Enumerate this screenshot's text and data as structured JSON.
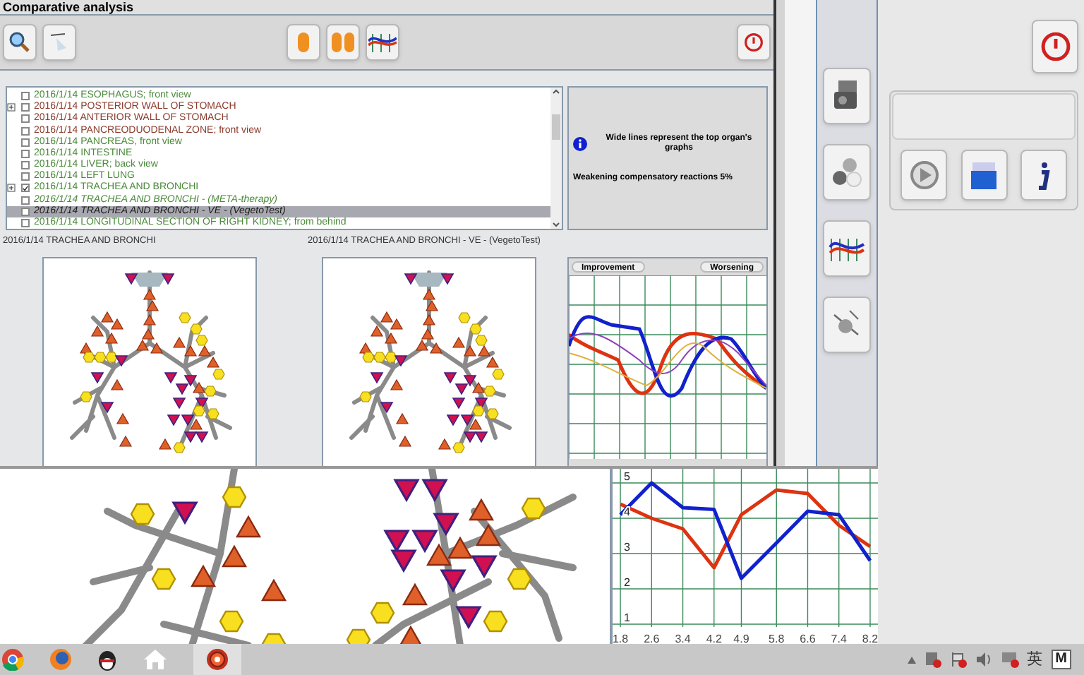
{
  "window": {
    "title": "Comparative analysis"
  },
  "list": [
    {
      "text": "2016/1/14  ESOPHAGUS; front view",
      "color": "#4a8a3a",
      "checked": false,
      "expandable": false,
      "italic": false,
      "selected": false
    },
    {
      "text": "2016/1/14  POSTERIOR WALL OF STOMACH",
      "color": "#8a3a2a",
      "checked": false,
      "expandable": true,
      "italic": false,
      "selected": false
    },
    {
      "text": "2016/1/14  ANTERIOR  WALL  OF  STOMACH",
      "color": "#8a3a2a",
      "checked": false,
      "expandable": false,
      "italic": false,
      "selected": false
    },
    {
      "text": "2016/1/14  PANCREODUODENAL ZONE; front view",
      "color": "#8a3a2a",
      "checked": false,
      "expandable": false,
      "italic": false,
      "selected": false
    },
    {
      "text": "2016/1/14  PANCREAS,  front  view",
      "color": "#4a8a3a",
      "checked": false,
      "expandable": false,
      "italic": false,
      "selected": false
    },
    {
      "text": "2016/1/14  INTESTINE",
      "color": "#4a8a3a",
      "checked": false,
      "expandable": false,
      "italic": false,
      "selected": false
    },
    {
      "text": "2016/1/14  LIVER; back view",
      "color": "#4a8a3a",
      "checked": false,
      "expandable": false,
      "italic": false,
      "selected": false
    },
    {
      "text": "2016/1/14  LEFT  LUNG",
      "color": "#4a8a3a",
      "checked": false,
      "expandable": false,
      "italic": false,
      "selected": false
    },
    {
      "text": "2016/1/14  TRACHEA  AND  BRONCHI",
      "color": "#4a8a3a",
      "checked": true,
      "expandable": true,
      "italic": false,
      "selected": false
    },
    {
      "text": "2016/1/14  TRACHEA  AND  BRONCHI - (META-therapy)",
      "color": "#4a8a3a",
      "checked": false,
      "expandable": false,
      "italic": true,
      "selected": false
    },
    {
      "text": "2016/1/14  TRACHEA  AND  BRONCHI - VE - (VegetoTest)",
      "checked": false,
      "expandable": false,
      "italic": true,
      "selected": true
    },
    {
      "text": "2016/1/14  LONGITUDINAL  SECTION  OF  RIGHT  KIDNEY; from behind",
      "color": "#4a8a3a",
      "checked": false,
      "expandable": false,
      "italic": false,
      "selected": false
    }
  ],
  "left_caption": "2016/1/14  TRACHEA  AND  BRONCHI",
  "right_caption": "2016/1/14  TRACHEA  AND  BRONCHI - VE - (VegetoTest)",
  "info": {
    "note": "Wide lines represent the top organ's graphs",
    "finding": "Weakening compensatory reactions 5%"
  },
  "small_chart": {
    "buttons": [
      "Improvement",
      "Worsening"
    ]
  },
  "big_chart": {
    "chart_data": {
      "type": "line",
      "x": [
        1.8,
        2.6,
        3.4,
        4.2,
        4.9,
        5.8,
        6.6,
        7.4,
        8.2
      ],
      "series": [
        {
          "color": "#dd3311",
          "values": [
            4.4,
            4.0,
            3.7,
            2.6,
            4.1,
            4.8,
            4.7,
            3.8,
            3.2
          ]
        },
        {
          "color": "#1122cc",
          "values": [
            4.1,
            5.0,
            4.3,
            4.25,
            2.3,
            3.3,
            4.2,
            4.1,
            2.8
          ]
        }
      ],
      "xticks": [
        {
          "value": 1.8,
          "label": "1.8"
        },
        {
          "value": 2.6,
          "label": "2.6"
        },
        {
          "value": 3.4,
          "label": "3.4"
        },
        {
          "value": 4.2,
          "label": "4.2"
        },
        {
          "value": 4.9,
          "label": "4.9"
        },
        {
          "value": 5.8,
          "label": "5.8"
        },
        {
          "value": 6.6,
          "label": "6.6"
        },
        {
          "value": 7.4,
          "label": "7.4"
        },
        {
          "value": 8.2,
          "label": "8.2"
        }
      ],
      "yticks": [
        1,
        2,
        3,
        4,
        5
      ],
      "xlim": [
        1.6,
        8.4
      ],
      "ylim": [
        1,
        5
      ],
      "grid": true
    }
  },
  "taskbar": {
    "tray": [
      "英",
      "M"
    ]
  }
}
